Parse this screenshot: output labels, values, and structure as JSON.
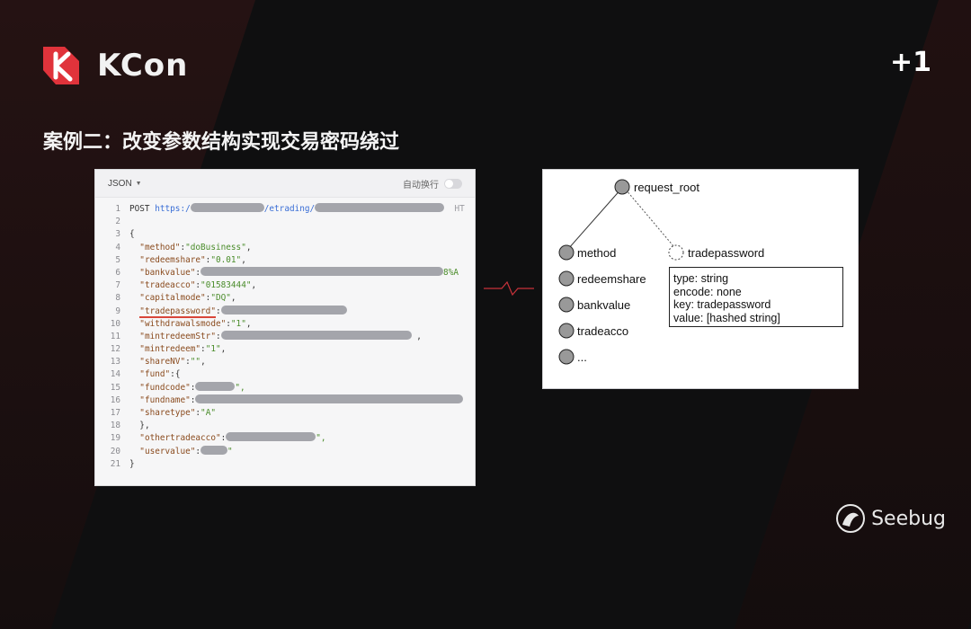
{
  "brand": {
    "name": "KCon",
    "badge": "+1",
    "footer": "Seebug"
  },
  "slide": {
    "title": "案例二：改变参数结构实现交易密码绕过"
  },
  "code_panel": {
    "format_label": "JSON",
    "wrap_label": "自动换行",
    "lines": [
      {
        "no": "1"
      },
      {
        "no": "2"
      },
      {
        "no": "3"
      },
      {
        "no": "4"
      },
      {
        "no": "5"
      },
      {
        "no": "6"
      },
      {
        "no": "7"
      },
      {
        "no": "8"
      },
      {
        "no": "9"
      },
      {
        "no": "10"
      },
      {
        "no": "11"
      },
      {
        "no": "12"
      },
      {
        "no": "13"
      },
      {
        "no": "14"
      },
      {
        "no": "15"
      },
      {
        "no": "16"
      },
      {
        "no": "17"
      },
      {
        "no": "18"
      },
      {
        "no": "19"
      },
      {
        "no": "20"
      },
      {
        "no": "21"
      }
    ],
    "tokens": {
      "post": "POST",
      "url_prefix": "https:/",
      "url_mid": "/etrading/",
      "http_suffix": "HT",
      "open_brace": "{",
      "close_brace": "}",
      "inner_open": "{",
      "inner_close": "},",
      "k_method": "\"method\"",
      "v_method": "\"doBusiness\"",
      "k_redeemshare": "\"redeemshare\"",
      "v_redeemshare": "\"0.01\"",
      "k_bankvalue": "\"bankvalue\"",
      "v_bankvalue_tail": "8%A",
      "k_tradeacco": "\"tradeacco\"",
      "v_tradeacco": "\"01583444\"",
      "k_capitalmode": "\"capitalmode\"",
      "v_capitalmode": "\"DQ\"",
      "k_tradepassword": "\"tradepassword\"",
      "k_withdrawalsmode": "\"withdrawalsmode\"",
      "v_withdrawalsmode": "\"1\"",
      "k_mintredeemStr": "\"mintredeemStr\"",
      "k_mintredeem": "\"mintredeem\"",
      "v_mintredeem": "\"1\"",
      "k_shareNV": "\"shareNV\"",
      "v_shareNV": "\"\"",
      "k_fund": "\"fund\"",
      "k_fundcode": "\"fundcode\"",
      "k_fundname": "\"fundname\"",
      "k_sharetype": "\"sharetype\"",
      "v_sharetype": "\"A\"",
      "k_othertradeacco": "\"othertradeacco\"",
      "k_uservalue": "\"uservalue\""
    }
  },
  "tree": {
    "root": "request_root",
    "children": [
      "method",
      "redeemshare",
      "bankvalue",
      "tradeacco",
      "..."
    ],
    "dashed_child": "tradepassword",
    "info": [
      "type: string",
      "encode: none",
      "key: tradepassword",
      "value: [hashed string]"
    ]
  }
}
